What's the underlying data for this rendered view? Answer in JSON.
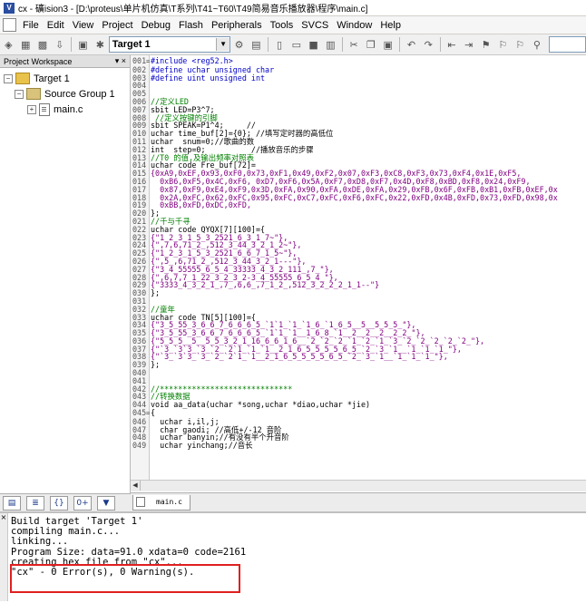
{
  "window": {
    "title": "cx - 礦ision3 - [D:\\proteus\\单片机仿真\\T系列\\T41~T60\\T49简易音乐播放器\\程序\\main.c]"
  },
  "menu": [
    "File",
    "Edit",
    "View",
    "Project",
    "Debug",
    "Flash",
    "Peripherals",
    "Tools",
    "SVCS",
    "Window",
    "Help"
  ],
  "toolbar": {
    "target": "Target 1"
  },
  "workspace": {
    "header": "Project Workspace",
    "tree": {
      "target": "Target 1",
      "group": "Source Group 1",
      "file": "main.c"
    }
  },
  "editor": {
    "tab": "main.c",
    "lines": [
      {
        "n": "001",
        "f": "=",
        "t": "#include <reg52.h>"
      },
      {
        "n": "002",
        "f": "",
        "t": "#define uchar unsigned char"
      },
      {
        "n": "003",
        "f": "",
        "t": "#define uint unsigned int"
      },
      {
        "n": "004",
        "f": "",
        "t": ""
      },
      {
        "n": "005",
        "f": "",
        "t": ""
      },
      {
        "n": "006",
        "f": "",
        "t": "//定义LED"
      },
      {
        "n": "007",
        "f": "",
        "t": "sbit LED=P3^7;"
      },
      {
        "n": "008",
        "f": "",
        "t": " //定义按键的引脚"
      },
      {
        "n": "009",
        "f": "",
        "t": "sbit SPEAK=P1^4;     //"
      },
      {
        "n": "010",
        "f": "",
        "t": "uchar time_buf[2]={0}; //填写定时器的高低位"
      },
      {
        "n": "011",
        "f": "",
        "t": "uchar  snum=0;//歌曲的数"
      },
      {
        "n": "012",
        "f": "",
        "t": "int  step=0;          //播放音乐的步骤"
      },
      {
        "n": "013",
        "f": "",
        "t": "//T0 的值,及输出频率对照表"
      },
      {
        "n": "014",
        "f": "",
        "t": "uchar code Fre_buf[72]="
      },
      {
        "n": "015",
        "f": "",
        "t": "{0xA9,0xEF,0x93,0xF0,0x73,0xF1,0x49,0xF2,0x07,0xF3,0xC8,0xF3,0x73,0xF4,0x1E,0xF5,"
      },
      {
        "n": "016",
        "f": "",
        "t": "  0xB6,0xF5,0x4C,0xF6, 0xD7,0xF6,0x5A,0xF7,0xD8,0xF7,0x4D,0xF8,0xBD,0xF8,0x24,0xF9,"
      },
      {
        "n": "017",
        "f": "",
        "t": "  0x87,0xF9,0xE4,0xF9,0x3D,0xFA,0x90,0xFA,0xDE,0xFA,0x29,0xFB,0x6F,0xFB,0xB1,0xFB,0xEF,0x"
      },
      {
        "n": "018",
        "f": "",
        "t": "  0x2A,0xFC,0x62,0xFC,0x95,0xFC,0xC7,0xFC,0xF6,0xFC,0x22,0xFD,0x4B,0xFD,0x73,0xFD,0x98,0x"
      },
      {
        "n": "019",
        "f": "",
        "t": "  0xBB,0xFD,0xDC,0xFD,"
      },
      {
        "n": "020",
        "f": "",
        "t": "};"
      },
      {
        "n": "021",
        "f": "",
        "t": "//千与千寻"
      },
      {
        "n": "022",
        "f": "",
        "t": "uchar code QYQX[7][100]={"
      },
      {
        "n": "023",
        "f": "",
        "t": "{\"1_2_3_1_5_3_2521_6_3_1_7~\"},"
      },
      {
        "n": "024",
        "f": "",
        "t": "{\",7,6,71_2_,512_3_44_3_2_1_2~\"},"
      },
      {
        "n": "025",
        "f": "",
        "t": "{\"1_2_3_1_5_3_2521_6_6_7_1_5~\"},"
      },
      {
        "n": "026",
        "f": "",
        "t": "{\",5_,6,71_2_,512_3_44_3_2_1---\"},"
      },
      {
        "n": "027",
        "f": "",
        "t": "{\"3_4_55555_6_5_4_33333_4_3_2_111_,7_\"},"
      },
      {
        "n": "028",
        "f": "",
        "t": "{\",6,7,7_1_22_3_2_3_2-3_4_55555_6_5_4_\"},"
      },
      {
        "n": "029",
        "f": "",
        "t": "{\"3333_4_3_2_1_,7_,6,6_,7_1_2_,512_3_2_2_2_1_1--\"}"
      },
      {
        "n": "030",
        "f": "",
        "t": "};"
      },
      {
        "n": "031",
        "f": "",
        "t": ""
      },
      {
        "n": "032",
        "f": "",
        "t": "//童年"
      },
      {
        "n": "033",
        "f": "",
        "t": "uchar code TN[5][100]={"
      },
      {
        "n": "034",
        "f": "",
        "t": "{\"3_5_55_3_6_6_7_6_6_6_5_`1`1_`1_`1_6_`1_6_5__5__5_5_5_\"},"
      },
      {
        "n": "035",
        "f": "",
        "t": "{\"3_5_55_3_6_6_7_6_6_6_5_`1`1_`1__1_6_8_`1__2__2__2__2_2_\"},"
      },
      {
        "n": "036",
        "f": "",
        "t": "{\"5_5_5__5__5_5_3_2_1_16_6_6_1_6__`2_`2_`2_`1_`2_`1_`3_`2_`2_`2_`2_`2_\"},"
      },
      {
        "n": "037",
        "f": "",
        "t": "{\"`3_`3`3_`3_`2_`2`1_`1_`1__2_1_6_5_5_5_5_6_5_`2_`3_`1__`1_`1_`1_\"},"
      },
      {
        "n": "038",
        "f": "",
        "t": "{\"`3_`3`3_`3_`2_`2`1_`1__2_1_6_5_5_5_5_6_5_`2_`3_`1__`1_`1_`1_\"},"
      },
      {
        "n": "039",
        "f": "",
        "t": "};"
      },
      {
        "n": "040",
        "f": "",
        "t": ""
      },
      {
        "n": "041",
        "f": "",
        "t": ""
      },
      {
        "n": "042",
        "f": "",
        "t": "//*****************************"
      },
      {
        "n": "043",
        "f": "",
        "t": "//转换数据"
      },
      {
        "n": "044",
        "f": "",
        "t": "void aa_data(uchar *song,uchar *diao,uchar *jie)"
      },
      {
        "n": "045",
        "f": "=",
        "t": "{"
      },
      {
        "n": "046",
        "f": "",
        "t": "  uchar i,il,j;"
      },
      {
        "n": "047",
        "f": "",
        "t": "  char gaodi; //高低+/-12 音阶"
      },
      {
        "n": "048",
        "f": "",
        "t": "  uchar banyin;//有没有半个升音阶"
      },
      {
        "n": "049",
        "f": "",
        "t": "  uchar yinchang;//音长"
      }
    ]
  },
  "output": {
    "lines": [
      "Build target 'Target 1'",
      "compiling main.c...",
      "linking...",
      "Program Size: data=91.0 xdata=0 code=2161",
      "creating hex file from \"cx\"...",
      "\"cx\" - 0 Error(s), 0 Warning(s)."
    ]
  }
}
